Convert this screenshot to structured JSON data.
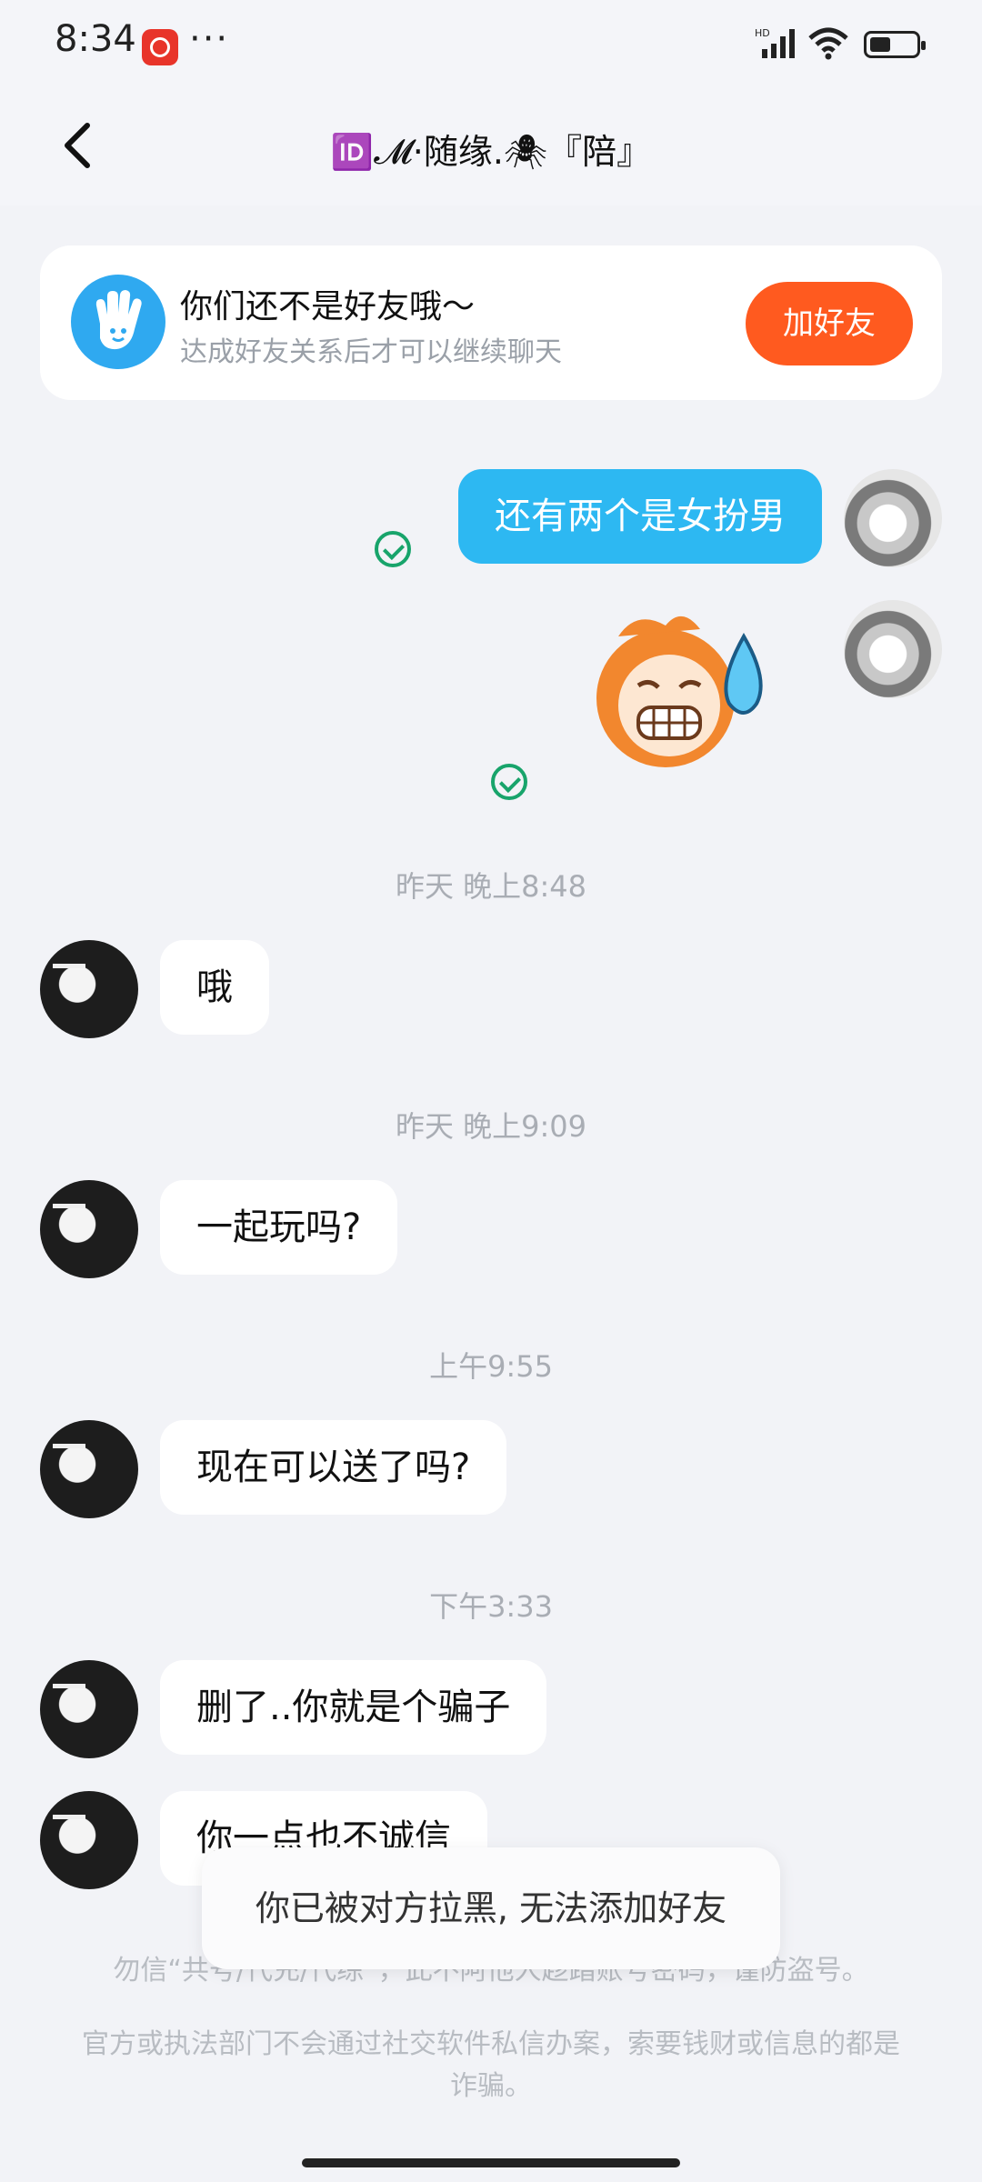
{
  "status_bar": {
    "time": "8:34",
    "more": "···",
    "network": "HD"
  },
  "header": {
    "title": "🆔𝓜·随缘.🕷『陪』"
  },
  "friend_notice": {
    "title": "你们还不是好友哦～",
    "subtitle": "达成好友关系后才可以继续聊天",
    "button": "加好友"
  },
  "messages": {
    "out_1": "还有两个是女扮男",
    "ts_1": "昨天 晚上8:48",
    "in_1": "哦",
    "ts_2": "昨天 晚上9:09",
    "in_2": "一起玩吗?",
    "ts_3": "上午9:55",
    "in_3": "现在可以送了吗?",
    "ts_4": "下午3:33",
    "in_4": "删了..你就是个骗子",
    "in_5": "你一点也不诚信"
  },
  "toast": "你已被对方拉黑, 无法添加好友",
  "footer": {
    "warning_1": "勿信“共号/代充/代练”，此不阿他人趁踏账号密码，谨防盗号。",
    "warning_2": "官方或执法部门不会通过社交软件私信办案，索要钱财或信息的都是诈骗。"
  },
  "colors": {
    "outgoing_bubble": "#2db8f2",
    "add_button": "#ff5a1f",
    "read_check": "#18a46b"
  },
  "icons": [
    "back-icon",
    "wave-hand-icon",
    "read-check-icon",
    "signal-icon",
    "wifi-icon",
    "battery-icon"
  ]
}
